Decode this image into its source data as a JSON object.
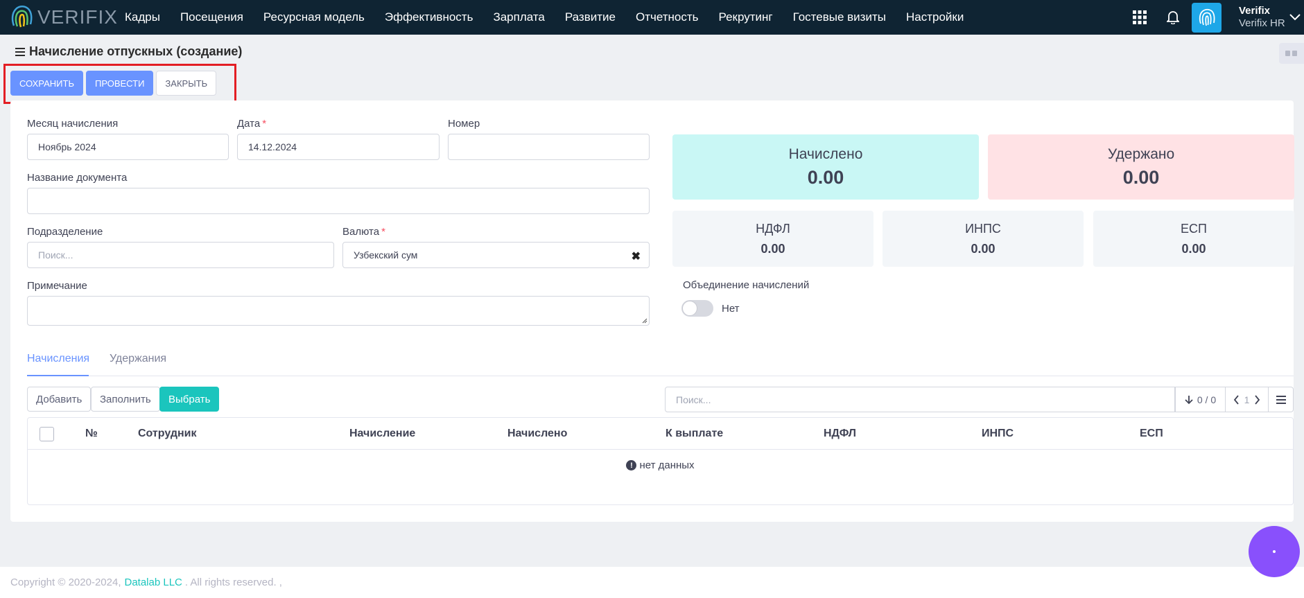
{
  "brand": {
    "logo_text": "VERIFIX"
  },
  "nav": {
    "items": [
      "Кадры",
      "Посещения",
      "Ресурсная модель",
      "Эффективность",
      "Зарплата",
      "Развитие",
      "Отчетность",
      "Рекрутинг",
      "Гостевые визиты",
      "Настройки"
    ],
    "icons": [
      "apps-grid-icon",
      "bell-icon"
    ]
  },
  "user": {
    "name": "Verifix",
    "org": "Verifix HR"
  },
  "page": {
    "title": "Начисление отпускных (создание)"
  },
  "toolbar": {
    "save_label": "СОХРАНИТЬ",
    "post_label": "ПРОВЕСТИ",
    "close_label": "ЗАКРЫТЬ"
  },
  "form": {
    "month_label": "Месяц начисления",
    "month_value": "Ноябрь 2024",
    "date_label": "Дата",
    "date_value": "14.12.2024",
    "number_label": "Номер",
    "number_value": "",
    "doc_name_label": "Название документа",
    "doc_name_value": "",
    "division_label": "Подразделение",
    "division_placeholder": "Поиск...",
    "currency_label": "Валюта",
    "currency_value": "Узбекский сум",
    "note_label": "Примечание",
    "note_value": "",
    "required_mark": "*"
  },
  "stats": {
    "accrued_title": "Начислено",
    "accrued_value": "0.00",
    "withheld_title": "Удержано",
    "withheld_value": "0.00",
    "ndfl_title": "НДФЛ",
    "ndfl_value": "0.00",
    "inps_title": "ИНПС",
    "inps_value": "0.00",
    "esp_title": "ЕСП",
    "esp_value": "0.00"
  },
  "merge": {
    "label": "Объединение начислений",
    "state_text": "Нет",
    "enabled": false
  },
  "tabs": {
    "accruals": "Начисления",
    "withholdings": "Удержания",
    "active": "accruals"
  },
  "grid": {
    "add_label": "Добавить",
    "fill_label": "Заполнить",
    "select_label": "Выбрать",
    "search_placeholder": "Поиск...",
    "count_text": "0 / 0",
    "page_text": "1",
    "columns": [
      "№",
      "Сотрудник",
      "Начисление",
      "Начислено",
      "К выплате",
      "НДФЛ",
      "ИНПС",
      "ЕСП"
    ],
    "empty_text": "нет данных"
  },
  "footer": {
    "prefix": "Copyright © 2020-2024,",
    "company": "Datalab LLC",
    "suffix": ". All rights reserved. ,"
  },
  "colors": {
    "nav_bg": "#0f2433",
    "primary": "#6993ff",
    "teal": "#1bc5bd",
    "accrued_bg": "#c9f7f5",
    "withheld_bg": "#ffe2e5",
    "tax_bg": "#f3f6f9",
    "fab": "#8950fc",
    "highlight": "#e31e24"
  }
}
